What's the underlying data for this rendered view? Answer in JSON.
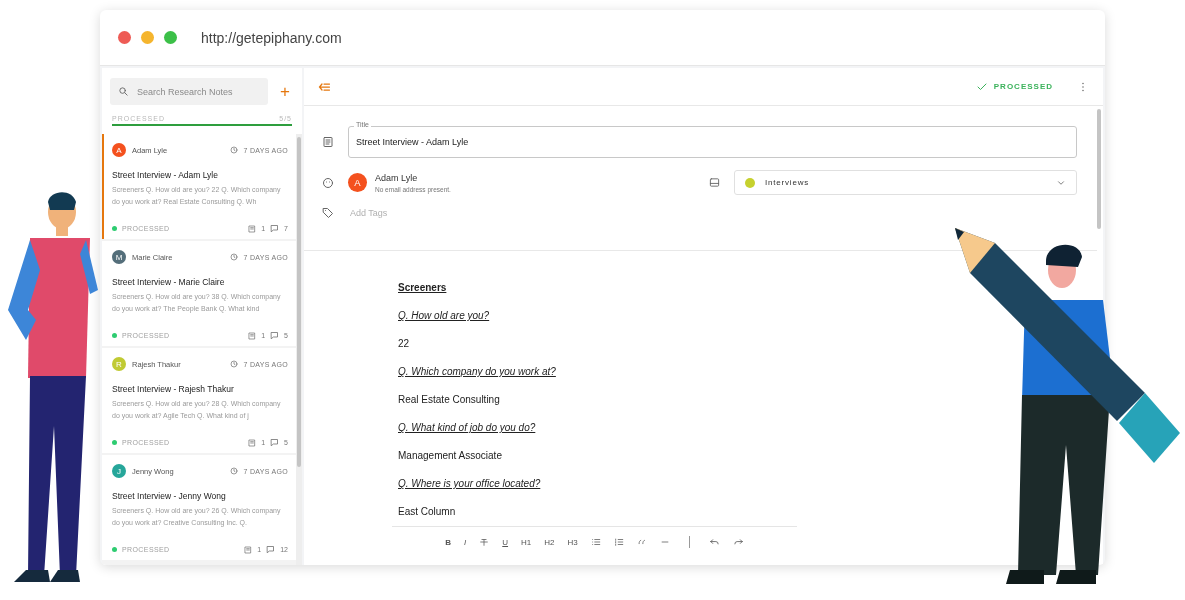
{
  "window": {
    "url": "http://getepiphany.com"
  },
  "sidebar": {
    "search": {
      "placeholder": "Search Research Notes"
    },
    "add_button": "+",
    "progress": {
      "label": "PROCESSED",
      "count": "5/5",
      "level": 1
    },
    "notes": [
      {
        "initial": "A",
        "author": "Adam Lyle",
        "color": "#f4511e",
        "time": "7 DAYS AGO",
        "title": "Street Interview - Adam Lyle",
        "excerpt": "Screeners Q. How old are you? 22 Q. Which company do you work at? Real Estate Consulting Q. Wh",
        "status": "PROCESSED",
        "attachments": "1",
        "comments": "7",
        "selected": true
      },
      {
        "initial": "M",
        "author": "Marie Claire",
        "color": "#546e7a",
        "time": "7 DAYS AGO",
        "title": "Street Interview - Marie Claire",
        "excerpt": "Screeners Q. How old are you? 38 Q. Which company do you work at? The People Bank Q. What kind",
        "status": "PROCESSED",
        "attachments": "1",
        "comments": "5",
        "selected": false
      },
      {
        "initial": "R",
        "author": "Rajesh Thakur",
        "color": "#c0ca33",
        "time": "7 DAYS AGO",
        "title": "Street Interview - Rajesh Thakur",
        "excerpt": "Screeners Q. How old are you? 28 Q. Which company do you work at? Agile Tech Q. What kind of j",
        "status": "PROCESSED",
        "attachments": "1",
        "comments": "5",
        "selected": false
      },
      {
        "initial": "J",
        "author": "Jenny Wong",
        "color": "#26a69a",
        "time": "7 DAYS AGO",
        "title": "Street Interview - Jenny Wong",
        "excerpt": "Screeners Q. How old are you? 26 Q. Which company do you work at? Creative Consulting Inc. Q.",
        "status": "PROCESSED",
        "attachments": "1",
        "comments": "12",
        "selected": false
      }
    ]
  },
  "main": {
    "status": "PROCESSED",
    "title_field": {
      "label": "Title",
      "value": "Street Interview - Adam Lyle"
    },
    "person": {
      "initial": "A",
      "name": "Adam Lyle",
      "email": "No email address present.",
      "color": "#f4511e"
    },
    "folder": {
      "value": "Interviews",
      "color": "#c6d12e"
    },
    "tags": {
      "placeholder": "Add Tags"
    },
    "editor": [
      {
        "kind": "heading",
        "text": "Screeners"
      },
      {
        "kind": "question",
        "text": "Q. How old are you?"
      },
      {
        "kind": "answer",
        "text": "22"
      },
      {
        "kind": "question",
        "text": "Q. Which company do you work at?"
      },
      {
        "kind": "answer",
        "text": "Real Estate Consulting"
      },
      {
        "kind": "question",
        "text": "Q. What kind of job do you do?"
      },
      {
        "kind": "answer",
        "text": "Management Associate"
      },
      {
        "kind": "question",
        "text": "Q. Where is your office located?"
      },
      {
        "kind": "answer",
        "text": "East Column"
      }
    ],
    "editor_toolbar": [
      {
        "kind": "bold",
        "label": "B"
      },
      {
        "kind": "italic",
        "label": "I"
      },
      {
        "kind": "strike"
      },
      {
        "kind": "underline",
        "label": "U"
      },
      {
        "kind": "text",
        "label": "H1"
      },
      {
        "kind": "text",
        "label": "H2"
      },
      {
        "kind": "text",
        "label": "H3"
      },
      {
        "kind": "bullets"
      },
      {
        "kind": "numbers"
      },
      {
        "kind": "quote"
      },
      {
        "kind": "rule"
      },
      {
        "kind": "divider"
      },
      {
        "kind": "undo"
      },
      {
        "kind": "redo"
      }
    ]
  }
}
